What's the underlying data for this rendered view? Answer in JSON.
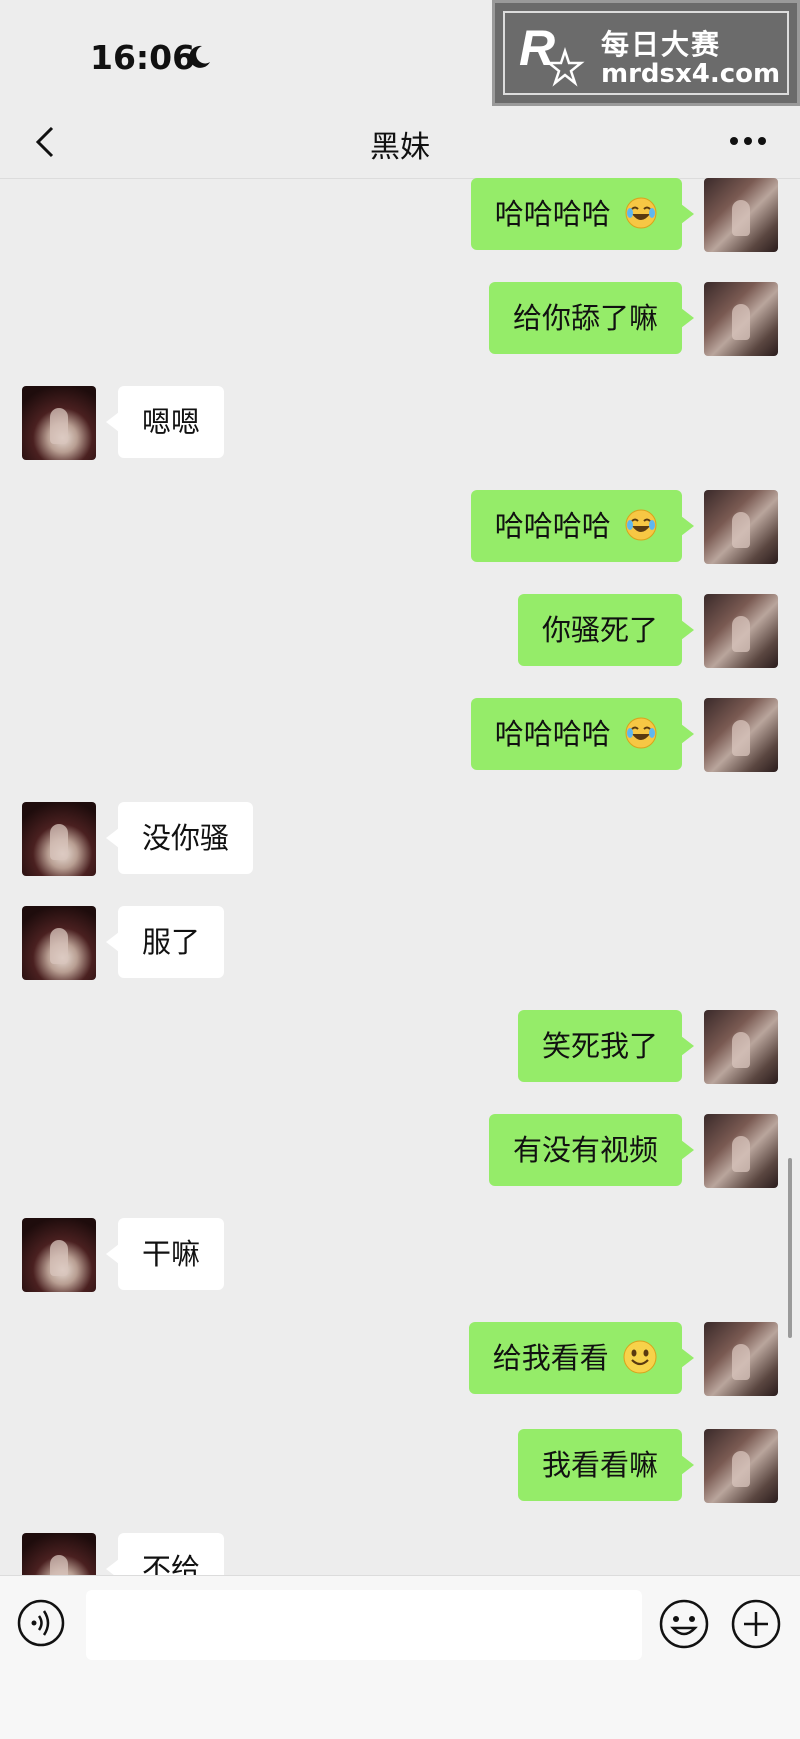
{
  "status": {
    "time": "16:06"
  },
  "watermark": {
    "line1": "每日大赛",
    "line2": "mrdsx4.com",
    "logo_small_text": "每日大赛"
  },
  "header": {
    "title": "黑妹"
  },
  "messages": [
    {
      "side": "me",
      "text": "哈哈哈哈",
      "emoji": "laugh-tears"
    },
    {
      "side": "me",
      "text": "给你舔了嘛"
    },
    {
      "side": "them",
      "text": "嗯嗯"
    },
    {
      "side": "me",
      "text": "哈哈哈哈",
      "emoji": "laugh-tears"
    },
    {
      "side": "me",
      "text": "你骚死了"
    },
    {
      "side": "me",
      "text": "哈哈哈哈",
      "emoji": "laugh-tears"
    },
    {
      "side": "them",
      "text": "没你骚"
    },
    {
      "side": "them",
      "text": "服了"
    },
    {
      "side": "me",
      "text": "笑死我了"
    },
    {
      "side": "me",
      "text": "有没有视频"
    },
    {
      "side": "them",
      "text": "干嘛"
    },
    {
      "side": "me",
      "text": "给我看看",
      "emoji": "smile"
    },
    {
      "side": "me",
      "text": "我看看嘛"
    },
    {
      "side": "them",
      "text": "不给"
    }
  ],
  "colors": {
    "my_bubble": "#95ec69",
    "their_bubble": "#ffffff",
    "background": "#ededed"
  },
  "icons": {
    "back": "chevron-left-icon",
    "more": "more-dots-icon",
    "voice": "voice-icon",
    "emoji": "emoji-icon",
    "add": "plus-icon"
  }
}
